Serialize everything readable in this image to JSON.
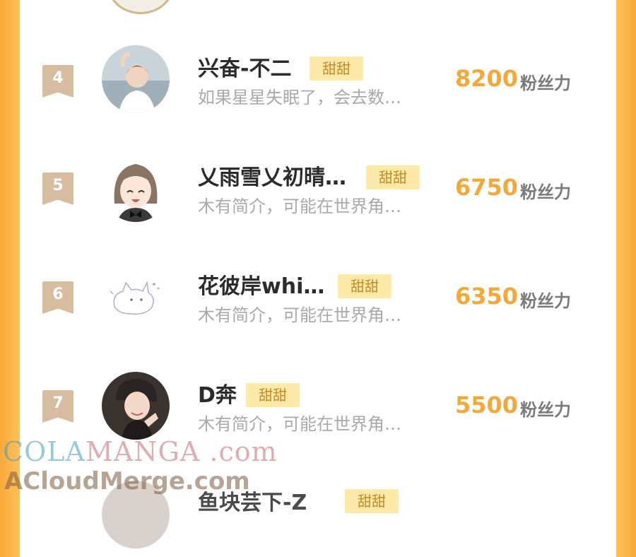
{
  "rows": [
    {
      "rank": "4",
      "name": "兴奋-不二",
      "tag": "甜甜",
      "bio": "如果星星失眠了，会去数…",
      "score": "8200",
      "unit": "粉丝力"
    },
    {
      "rank": "5",
      "name": "乂雨雪乂初晴…",
      "tag": "甜甜",
      "bio": "木有简介，可能在世界角…",
      "score": "6750",
      "unit": "粉丝力"
    },
    {
      "rank": "6",
      "name": "花彼岸whi…",
      "tag": "甜甜",
      "bio": "木有简介，可能在世界角…",
      "score": "6350",
      "unit": "粉丝力"
    },
    {
      "rank": "7",
      "name": "D奔",
      "tag": "甜甜",
      "bio": "木有简介，可能在世界角…",
      "score": "5500",
      "unit": "粉丝力"
    },
    {
      "rank": "",
      "name": "鱼块芸下-Z",
      "tag": "甜甜",
      "bio": "",
      "score": "",
      "unit": ""
    }
  ],
  "watermark": {
    "line1_a": "COLA",
    "line1_b": "MANGA",
    "line1_c": " .com",
    "line2": "ACloudMerge.com"
  },
  "colors": {
    "accent": "#f3a93a",
    "tag_bg": "#fdeaa8",
    "badge": "#d7bc9f",
    "frame": "#f9a93a"
  }
}
